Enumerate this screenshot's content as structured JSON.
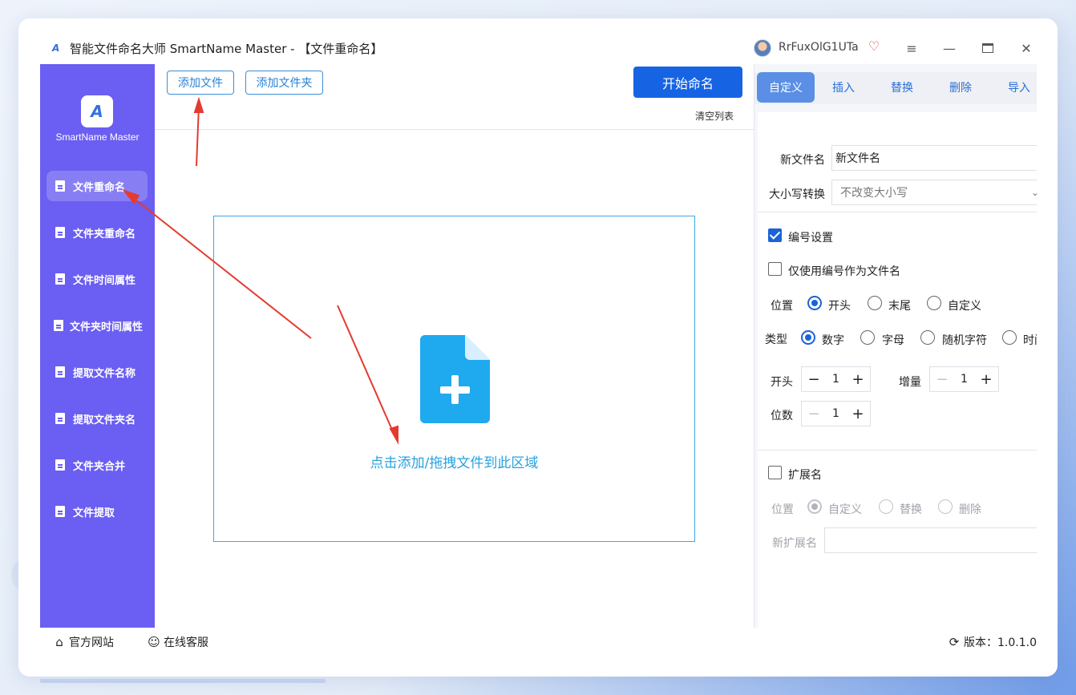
{
  "window": {
    "title": "智能文件命名大师 SmartName Master - 【文件重命名】",
    "user_name": "RrFuxOlG1UTa"
  },
  "sidebar": {
    "brand_name": "SmartName Master",
    "items": [
      {
        "label": "文件重命名"
      },
      {
        "label": "文件夹重命名"
      },
      {
        "label": "文件时间属性"
      },
      {
        "label": "文件夹时间属性"
      },
      {
        "label": "提取文件名称"
      },
      {
        "label": "提取文件夹名"
      },
      {
        "label": "文件夹合并"
      },
      {
        "label": "文件提取"
      }
    ]
  },
  "toolbar": {
    "add_file": "添加文件",
    "add_folder": "添加文件夹",
    "start": "开始命名",
    "clear": "清空列表"
  },
  "dropzone": {
    "text": "点击添加/拖拽文件到此区域"
  },
  "panel": {
    "tabs": [
      "自定义",
      "插入",
      "替换",
      "删除",
      "导入"
    ],
    "new_name_label": "新文件名",
    "new_name_value": "新文件名",
    "case_label": "大小写转换",
    "case_value": "不改变大小写",
    "numbering_label": "编号设置",
    "only_number_label": "仅使用编号作为文件名",
    "position_label": "位置",
    "position_options": [
      "开头",
      "末尾",
      "自定义"
    ],
    "type_label": "类型",
    "type_options": [
      "数字",
      "字母",
      "随机字符",
      "时间"
    ],
    "start_label": "开头",
    "start_value": "1",
    "increment_label": "增量",
    "increment_value": "1",
    "digits_label": "位数",
    "digits_value": "1",
    "ext_label": "扩展名",
    "ext_position_label": "位置",
    "ext_position_options": [
      "自定义",
      "替换",
      "删除"
    ],
    "new_ext_label": "新扩展名"
  },
  "footer": {
    "website": "官方网站",
    "support": "在线客服",
    "version": "版本：1.0.1.0"
  },
  "colors": {
    "sidebar": "#6b5ef2",
    "primary": "#1664e4",
    "accent": "#27a2df",
    "annotation": "#e53a2f"
  }
}
